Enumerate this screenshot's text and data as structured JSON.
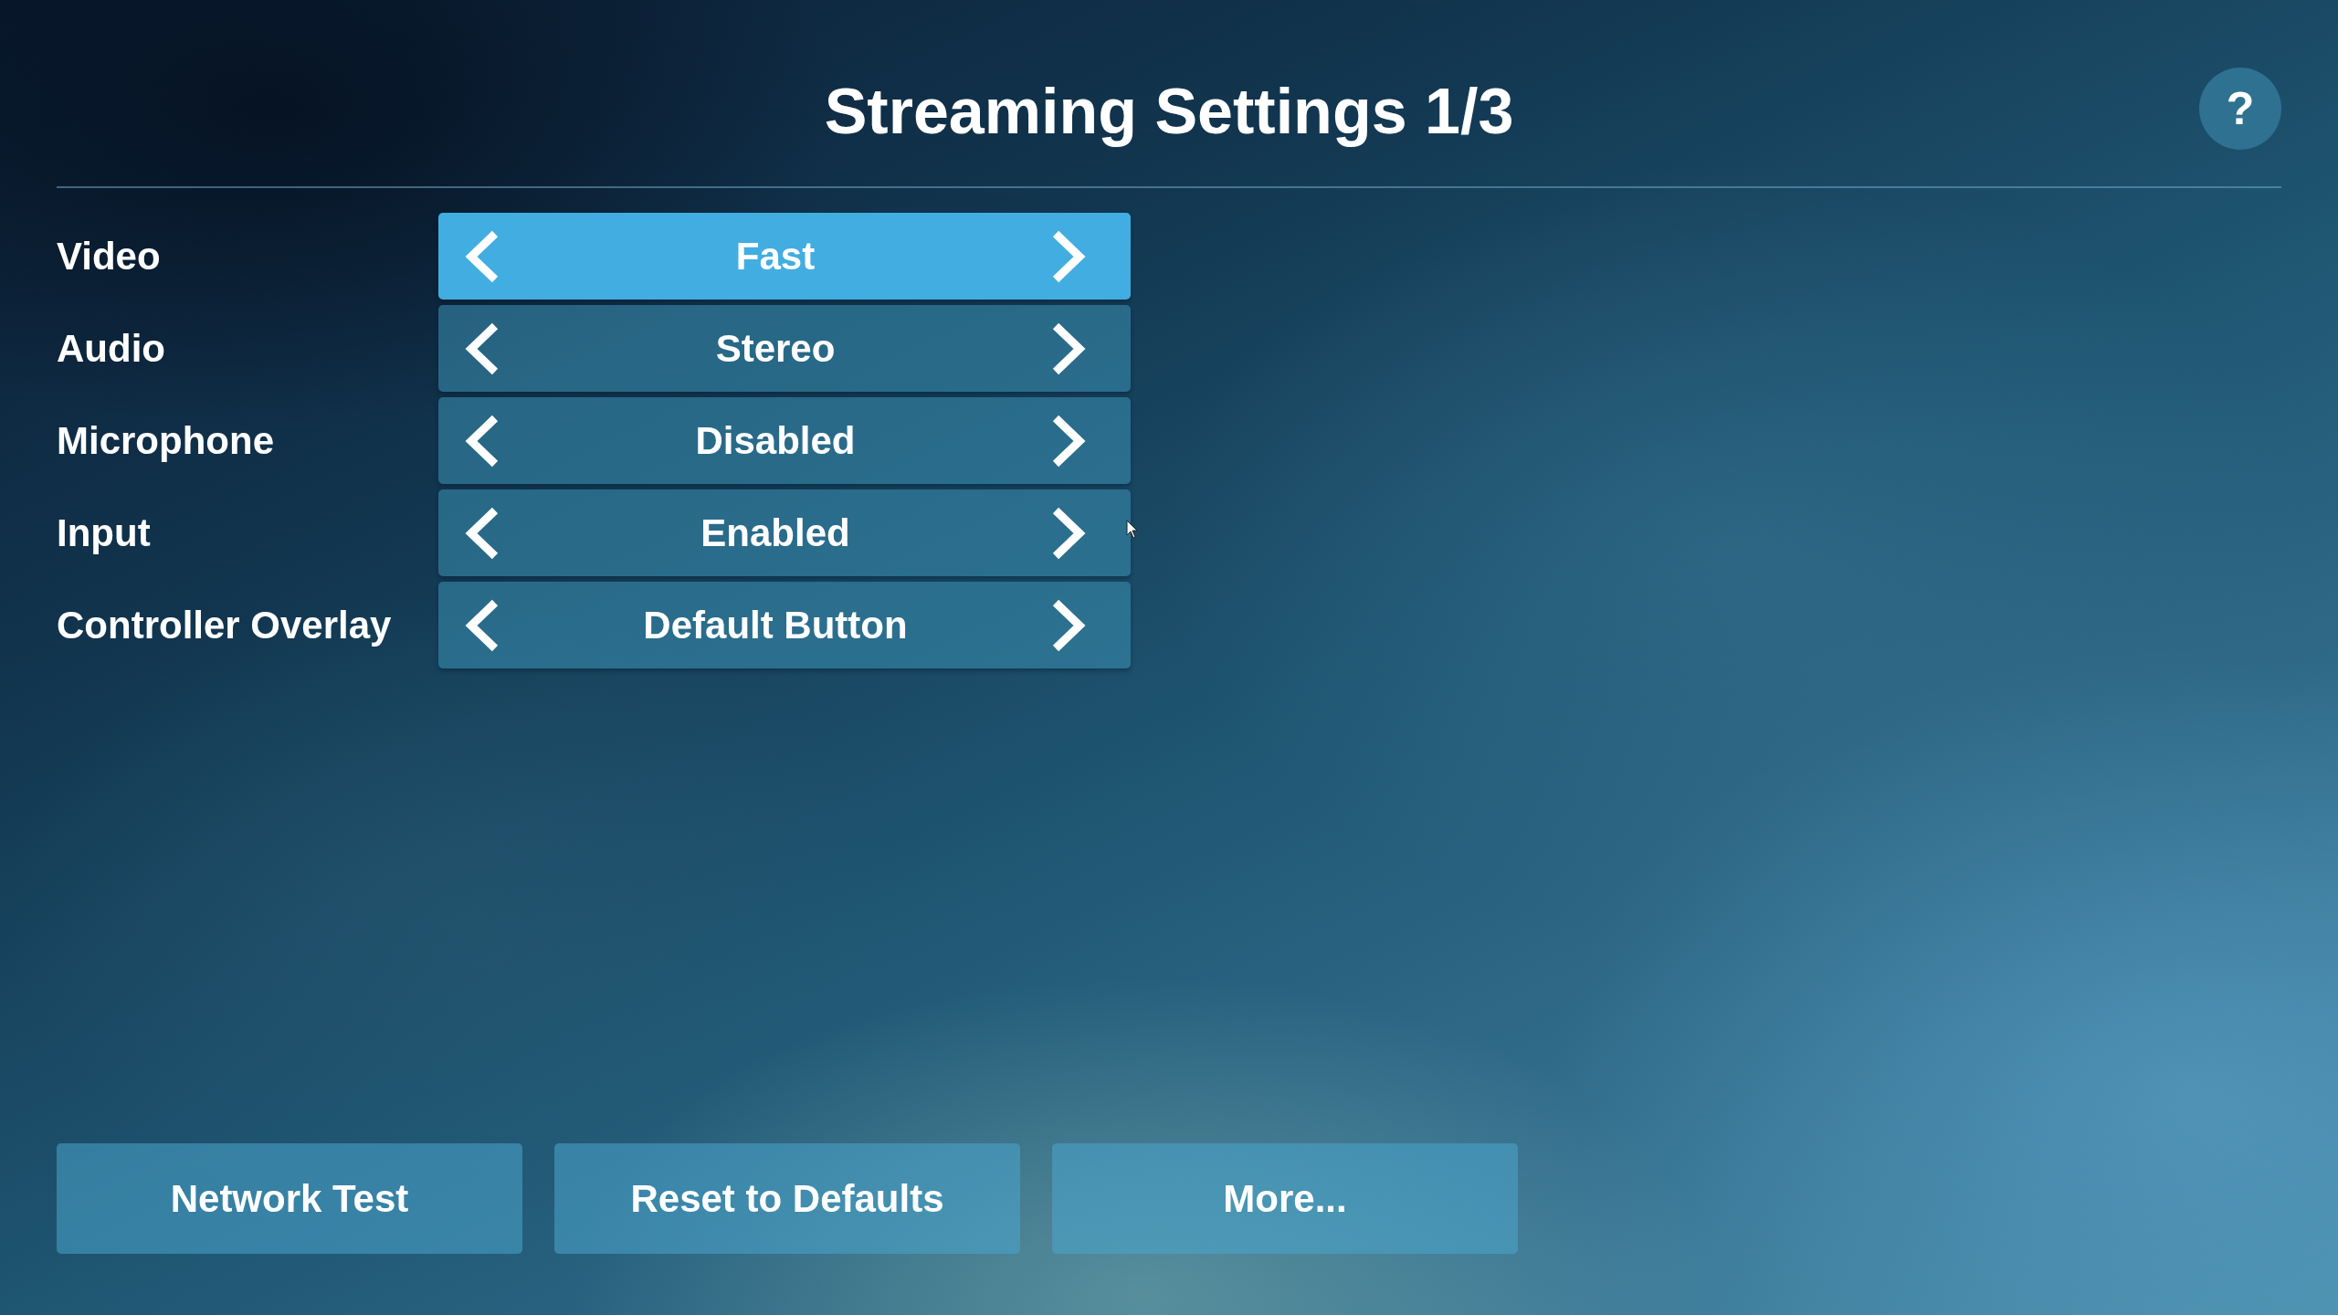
{
  "header": {
    "title": "Streaming Settings 1/3",
    "help_button": "?"
  },
  "settings": [
    {
      "label": "Video",
      "value": "Fast",
      "selected": true
    },
    {
      "label": "Audio",
      "value": "Stereo",
      "selected": false
    },
    {
      "label": "Microphone",
      "value": "Disabled",
      "selected": false
    },
    {
      "label": "Input",
      "value": "Enabled",
      "selected": false
    },
    {
      "label": "Controller Overlay",
      "value": "Default Button",
      "selected": false
    }
  ],
  "buttons": [
    "Network Test",
    "Reset to Defaults",
    "More..."
  ]
}
